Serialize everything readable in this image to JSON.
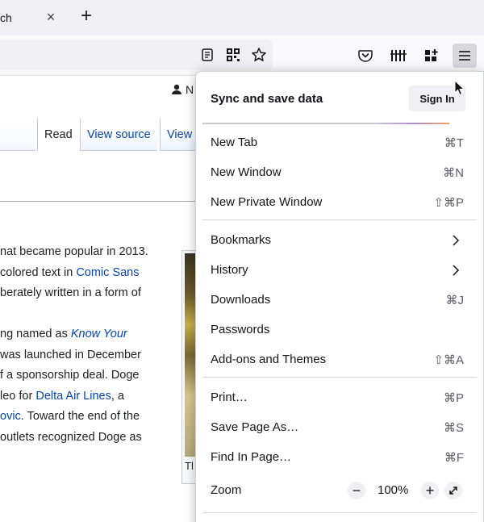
{
  "tabstrip": {
    "tab_title_fragment": "ch",
    "close_glyph": "×",
    "new_tab_glyph": "+"
  },
  "toolbar": {
    "icons": [
      "reader-view-icon",
      "qr-code-icon",
      "bookmark-star-icon",
      "pocket-icon",
      "library-icon",
      "extensions-icon",
      "hamburger-menu-icon"
    ]
  },
  "wiki": {
    "user_link_fragment": "N",
    "tabs": [
      "Read",
      "View source",
      "View"
    ],
    "thumb_caption_fragment": "Tl",
    "lines": [
      [
        {
          "t": "nat became popular in 2013."
        }
      ],
      [
        {
          "t": "colored text in "
        },
        {
          "t": "Comic Sans",
          "link": true
        }
      ],
      [
        {
          "t": "berately written in a form of"
        }
      ],
      [],
      [
        {
          "t": "ng named as "
        },
        {
          "t": "Know Your",
          "link": true,
          "italic": true
        }
      ],
      [
        {
          "t": " was launched in December"
        }
      ],
      [
        {
          "t": "f a sponsorship deal. Doge"
        }
      ],
      [
        {
          "t": "leo for "
        },
        {
          "t": "Delta Air Lines",
          "link": true
        },
        {
          "t": ", a"
        }
      ],
      [
        {
          "t": "ovic",
          "link": true
        },
        {
          "t": ". Toward the end of the"
        }
      ],
      [
        {
          "t": " outlets recognized Doge as"
        }
      ]
    ]
  },
  "menu": {
    "header_title": "Sync and save data",
    "signin_label": "Sign In",
    "items_group1": [
      {
        "label": "New Tab",
        "shortcut": "⌘T"
      },
      {
        "label": "New Window",
        "shortcut": "⌘N"
      },
      {
        "label": "New Private Window",
        "shortcut": "⇧⌘P"
      }
    ],
    "items_group2": [
      {
        "label": "Bookmarks",
        "chevron": true
      },
      {
        "label": "History",
        "chevron": true
      },
      {
        "label": "Downloads",
        "shortcut": "⌘J"
      },
      {
        "label": "Passwords",
        "shortcut": ""
      },
      {
        "label": "Add-ons and Themes",
        "shortcut": "⇧⌘A"
      }
    ],
    "items_group3": [
      {
        "label": "Print…",
        "shortcut": "⌘P"
      },
      {
        "label": "Save Page As…",
        "shortcut": "⌘S"
      },
      {
        "label": "Find In Page…",
        "shortcut": "⌘F"
      }
    ],
    "zoom": {
      "label": "Zoom",
      "minus": "−",
      "value": "100%",
      "plus": "+"
    }
  }
}
